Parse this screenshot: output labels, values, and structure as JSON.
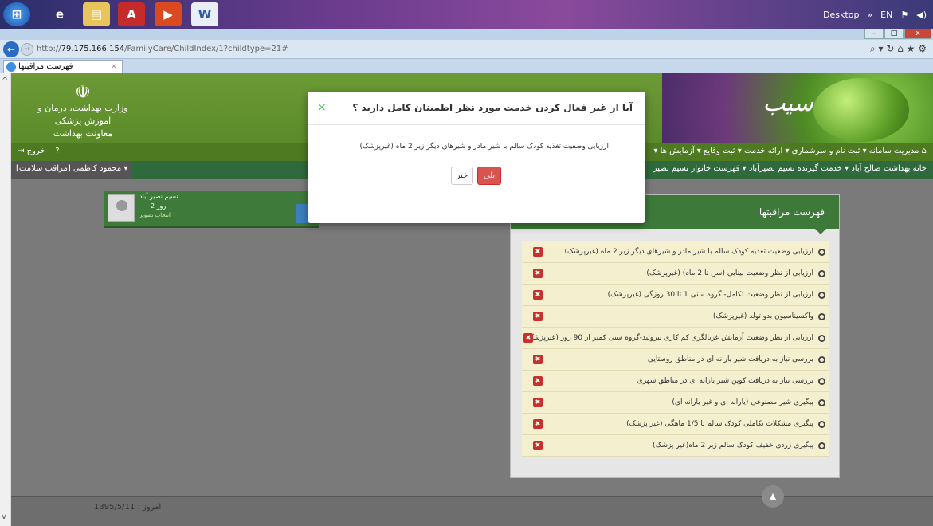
{
  "taskbar": {
    "desktop_label": "Desktop",
    "lang": "EN"
  },
  "browser": {
    "url_prefix": "http://",
    "url_host": "79.175.166.154",
    "url_path": "/FamilyCare/ChildIndex/1?childtype=21#",
    "tab_title": "فهرست مراقبتها",
    "addr_right": "⌕ ▾ ↻  ⌂ ★ ⚙"
  },
  "header": {
    "ministry_line1": "وزارت بهداشت، درمان و آموزش پزشکی",
    "ministry_line2": "معاونت بهداشت",
    "brand": "سیب"
  },
  "navbar": {
    "items": "مدیریت سامانه ▾   ثبت نام و سرشماری ▾   ارائه خدمت ▾   ثبت وقایع ▾   آزمایش ها ▾",
    "exit": "خروج",
    "help": "?"
  },
  "subbar": {
    "right": "خانه بهداشت صالح آباد ▾   خدمت گیرنده نسیم نصیرآباد ▾   فهرست خانوار نسیم نصیر",
    "user": "محمود کاظمی [مراقب سلامت] ▾"
  },
  "profile": {
    "name": "نسیم نصیر آباد",
    "age": "2 روز",
    "link": "انتخاب تصویر"
  },
  "panel": {
    "title": "فهرست مراقبتها",
    "items": [
      "ارزیابی وضعیت تغذیه کودک سالم با شیر مادر و شیرهای دیگر زیر 2 ماه (غیرپزشک)",
      "ارزیابی از نظر وضعیت بینایی (سن تا 2 ماه) (غیرپزشک)",
      "ارزیابی از نظر وضعیت تکامل- گروه سنی 1 تا 30 روزگی (غیرپزشک)",
      "واکسیناسیون بدو تولد (غیرپزشک)",
      "ارزیابی از نظر وضعیت آزمایش غربالگری کم کاری تیروئید-گروه سنی کمتر از 90 روز (غیرپزشک)",
      "بررسی نیاز به دریافت شیر یارانه ای در مناطق روستایی",
      "بررسی نیاز به دریافت کوپن شیر یارانه ای در مناطق شهری",
      "پیگیری شیر مصنوعی (یارانه ای و غیر یارانه ای)",
      "پیگیری مشکلات تکاملی کودک سالم تا 1/5 ماهگی (غیر پزشک)",
      "پیگیری زردی خفیف کودک سالم زیر 2 ماه(غیر پزشک)"
    ]
  },
  "modal": {
    "title": "آیا از غیر فعال کردن خدمت مورد نظر اطمینان کامل دارید ؟",
    "message": "ارزیابی وضعیت تغذیه کودک سالم با شیر مادر و شیرهای دیگر زیر 2 ماه (غیرپزشک)",
    "yes": "بلی",
    "no": "خیر",
    "close": "×"
  },
  "footer": {
    "date": "امروز : 1395/5/11"
  },
  "colors": {
    "header_green": "#6c9a35",
    "nav_green": "#4e7a22",
    "subbar_green": "#2f6a3c",
    "panel_green": "#3d7a3a",
    "danger": "#d9534f"
  }
}
